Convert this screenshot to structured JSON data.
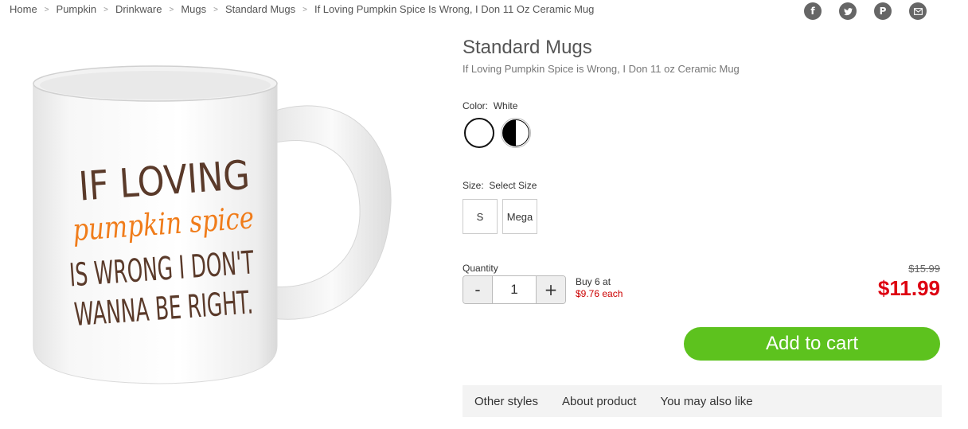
{
  "breadcrumb": {
    "items": [
      "Home",
      "Pumpkin",
      "Drinkware",
      "Mugs",
      "Standard Mugs",
      "If Loving Pumpkin Spice Is Wrong, I Don 11 Oz Ceramic Mug"
    ],
    "separator": ">"
  },
  "social": {
    "icons": [
      "facebook-icon",
      "twitter-icon",
      "pinterest-icon",
      "email-icon"
    ],
    "facebook_glyph": "f",
    "pinterest_glyph": "P"
  },
  "product": {
    "title": "Standard Mugs",
    "subtitle": "If Loving Pumpkin Spice is Wrong, I Don 11 oz Ceramic Mug",
    "image": {
      "line1": "IF LOVING",
      "line2": "pumpkin spice",
      "line3": "IS WRONG I DON'T",
      "line4": "WANNA BE RIGHT.",
      "text_color": "#5a3a2a",
      "accent_color": "#f07c1a"
    }
  },
  "color": {
    "label": "Color:",
    "value": "White",
    "options": [
      "White",
      "Black/White"
    ]
  },
  "size": {
    "label": "Size:",
    "value": "Select Size",
    "options": [
      "S",
      "Mega"
    ]
  },
  "quantity": {
    "label": "Quantity",
    "minus": "-",
    "plus": "+",
    "value": "1",
    "bulk_line1": "Buy 6 at",
    "bulk_line2": "$9.76 each"
  },
  "price": {
    "old": "$15.99",
    "current": "$11.99",
    "color": "#dd0011"
  },
  "cart": {
    "label": "Add to cart",
    "color": "#5dc21e"
  },
  "tabs": [
    "Other styles",
    "About product",
    "You may also like"
  ]
}
